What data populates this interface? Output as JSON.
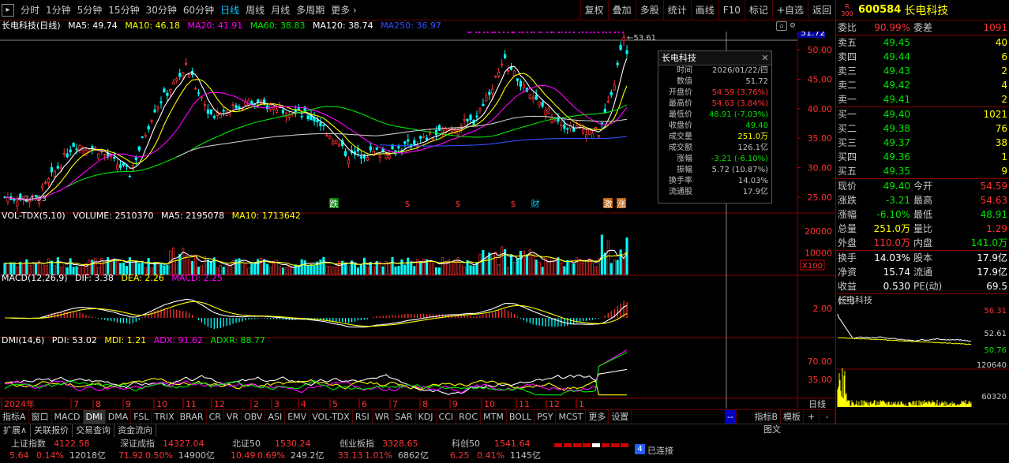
{
  "toolbar": {
    "periods": [
      "分时",
      "1分钟",
      "5分钟",
      "15分钟",
      "30分钟",
      "60分钟",
      "日线",
      "周线",
      "月线",
      "多周期",
      "更多"
    ],
    "active_period": "日线",
    "buttons": [
      "复权",
      "叠加",
      "多股",
      "统计",
      "画线",
      "F10",
      "标记",
      "+自选",
      "返回"
    ]
  },
  "ma_line": {
    "title": "长电科技(日线)",
    "ma5": "MA5: 49.74",
    "ma10": "MA10: 46.18",
    "ma20": "MA20: 41.91",
    "ma60": "MA60: 38.83",
    "ma120": "MA120: 38.74",
    "ma250": "MA250: 36.97"
  },
  "price_axis": [
    "50.00",
    "45.00",
    "40.00",
    "35.00",
    "30.00",
    "25.00"
  ],
  "price_tag": "51.72",
  "high_mark": "53.61",
  "low_mark": "24.53",
  "events": [
    "跌",
    "$",
    "$",
    "$",
    "财",
    "激",
    "涨"
  ],
  "vol": {
    "label": "VOL-TDX(5,10)",
    "volume": "VOLUME: 2510370",
    "ma5": "MA5: 2195078",
    "ma10": "MA10: 1713642",
    "axis": [
      "20000",
      "10000"
    ],
    "unit": "X100"
  },
  "macd": {
    "label": "MACD(12,26,9)",
    "dif": "DIF: 3.38",
    "dea": "DEA: 2.26",
    "macd": "MACD: 2.25",
    "axis": [
      "2.00"
    ]
  },
  "dmi": {
    "label": "DMI(14,6)",
    "pdi": "PDI: 53.02",
    "mdi": "MDI: 1.21",
    "adx": "ADX: 91.62",
    "adxr": "ADXR: 88.77",
    "axis": [
      "70.00",
      "35.00"
    ]
  },
  "date_axis": [
    "2024年",
    "7",
    "8",
    "9",
    "10",
    "11",
    "12",
    "2",
    "3",
    "4",
    "5",
    "6",
    "7",
    "8",
    "9",
    "10",
    "11",
    "12",
    "1"
  ],
  "date_right": "日线",
  "infobox": {
    "title": "长电科技",
    "rows": [
      {
        "k": "时间",
        "v": "2026/01/22/四",
        "c": "gray"
      },
      {
        "k": "数值",
        "v": "51.72",
        "c": "gray"
      },
      {
        "k": "开盘价",
        "v": "54.59 (3.76%)",
        "c": "red"
      },
      {
        "k": "最高价",
        "v": "54.63 (3.84%)",
        "c": "red"
      },
      {
        "k": "最低价",
        "v": "48.91 (-7.03%)",
        "c": "green"
      },
      {
        "k": "收盘价",
        "v": "49.40",
        "c": "green"
      },
      {
        "k": "成交量",
        "v": "251.0万",
        "c": "yellow"
      },
      {
        "k": "成交额",
        "v": "126.1亿",
        "c": "gray"
      },
      {
        "k": "涨幅",
        "v": "-3.21 (-6.10%)",
        "c": "green"
      },
      {
        "k": "振幅",
        "v": "5.72 (10.87%)",
        "c": "gray"
      },
      {
        "k": "换手率",
        "v": "14.03%",
        "c": "gray"
      },
      {
        "k": "流通股",
        "v": "17.9亿",
        "c": "gray"
      }
    ]
  },
  "indicator_tabs": [
    "指标A",
    "窗口",
    "MACD",
    "DMI",
    "DMA",
    "FSL",
    "TRIX",
    "BRAR",
    "CR",
    "VR",
    "OBV",
    "ASI",
    "EMV",
    "VOL-TDX",
    "RSI",
    "WR",
    "SAR",
    "KDJ",
    "CCI",
    "ROC",
    "MTM",
    "BOLL",
    "PSY",
    "MCST",
    "更多",
    "设置"
  ],
  "indicator_tabs_right": [
    "指标B",
    "模板"
  ],
  "bottom_tabs": [
    "扩展∧",
    "关联报价",
    "交易查询",
    "资金流向"
  ],
  "bottom_right": "图文",
  "indices": [
    {
      "name": "上证指数",
      "val": "4122.58",
      "chg": "5.64",
      "pct": "0.14%",
      "amt": "12018亿"
    },
    {
      "name": "深证成指",
      "val": "14327.04",
      "chg": "71.92",
      "pct": "0.50%",
      "amt": "14900亿"
    },
    {
      "name": "北证50",
      "val": "1530.24",
      "chg": "10.49",
      "pct": "0.69%",
      "amt": "249.2亿"
    },
    {
      "name": "创业板指",
      "val": "3328.65",
      "chg": "33.13",
      "pct": "1.01%",
      "amt": "6862亿"
    },
    {
      "name": "科创50",
      "val": "1541.64",
      "chg": "6.25",
      "pct": "0.41%",
      "amt": "1145亿"
    }
  ],
  "connection": {
    "num": "4",
    "text": "已连接"
  },
  "side": {
    "badge_top": "R",
    "badge_bot": "300",
    "code": "600584",
    "name": "长电科技",
    "weibi_k": "委比",
    "weibi_v": "90.99%",
    "weicha_k": "委差",
    "weicha_v": "1091",
    "sells": [
      {
        "k": "卖五",
        "p": "49.45",
        "q": "40"
      },
      {
        "k": "卖四",
        "p": "49.44",
        "q": "6"
      },
      {
        "k": "卖三",
        "p": "49.43",
        "q": "2"
      },
      {
        "k": "卖二",
        "p": "49.42",
        "q": "4"
      },
      {
        "k": "卖一",
        "p": "49.41",
        "q": "2"
      }
    ],
    "buys": [
      {
        "k": "买一",
        "p": "49.40",
        "q": "1021"
      },
      {
        "k": "买二",
        "p": "49.38",
        "q": "76"
      },
      {
        "k": "买三",
        "p": "49.37",
        "q": "38"
      },
      {
        "k": "买四",
        "p": "49.36",
        "q": "1"
      },
      {
        "k": "买五",
        "p": "49.35",
        "q": "9"
      }
    ],
    "quotes": [
      {
        "k1": "现价",
        "v1": "49.40",
        "c1": "green",
        "k2": "今开",
        "v2": "54.59",
        "c2": "red"
      },
      {
        "k1": "涨跌",
        "v1": "-3.21",
        "c1": "green",
        "k2": "最高",
        "v2": "54.63",
        "c2": "red"
      },
      {
        "k1": "涨幅",
        "v1": "-6.10%",
        "c1": "green",
        "k2": "最低",
        "v2": "48.91",
        "c2": "green"
      },
      {
        "k1": "总量",
        "v1": "251.0万",
        "c1": "yellow",
        "k2": "量比",
        "v2": "1.29",
        "c2": "red"
      },
      {
        "k1": "外盘",
        "v1": "110.0万",
        "c1": "red",
        "k2": "内盘",
        "v2": "141.0万",
        "c2": "green"
      }
    ],
    "stats": [
      {
        "k1": "换手",
        "v1": "14.03%",
        "k2": "股本",
        "v2": "17.9亿"
      },
      {
        "k1": "净资",
        "v1": "15.74",
        "k2": "流通",
        "v2": "17.9亿"
      },
      {
        "k1": "收益(三)",
        "v1": "0.530",
        "k2": "PE(动)",
        "v2": "69.5"
      }
    ],
    "mini_title": "长电科技",
    "mini_axis": [
      "56.31",
      "52.61",
      "50.76",
      "120640",
      "60320"
    ]
  }
}
